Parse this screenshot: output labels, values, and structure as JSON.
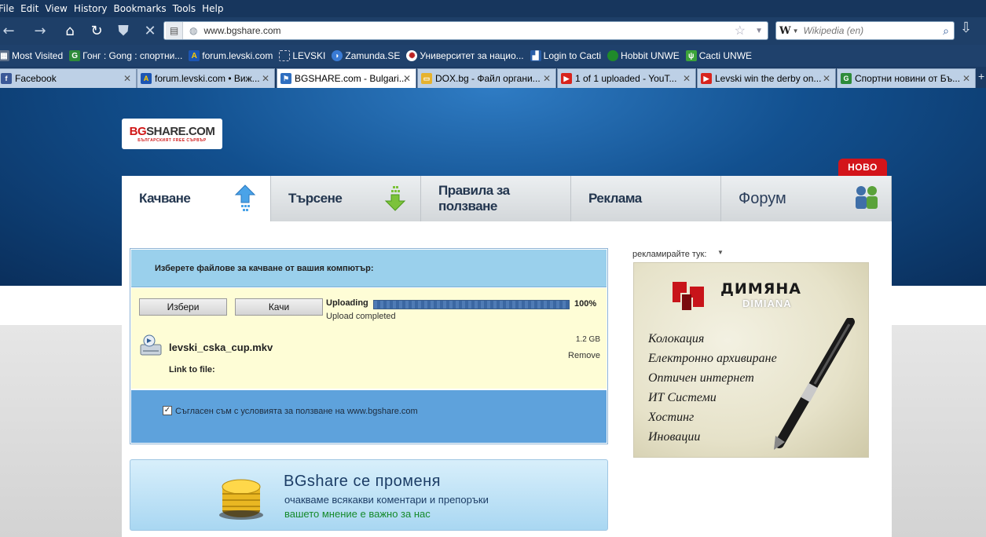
{
  "browser": {
    "menu": [
      "File",
      "Edit",
      "View",
      "History",
      "Bookmarks",
      "Tools",
      "Help"
    ],
    "url": "www.bgshare.com",
    "search_placeholder": "Wikipedia (en)",
    "search_engine_letter": "W",
    "bookmarks": [
      {
        "label": "Most Visited",
        "icon_color": "#5b6e88"
      },
      {
        "label": "Гонг : Gong : спортни...",
        "icon_color": "#2e8b3a"
      },
      {
        "label": "forum.levski.com",
        "icon_color": "#1c55b3"
      },
      {
        "label": "LEVSKI",
        "icon_color": "#ffffff"
      },
      {
        "label": "Zamunda.SE",
        "icon_color": "#3a7bd5"
      },
      {
        "label": "Университет за нацио...",
        "icon_color": "#b22"
      },
      {
        "label": "Login to Cacti",
        "icon_color": "#2a5fa8"
      },
      {
        "label": "Hobbit UNWE",
        "icon_color": "#1f8a2a"
      },
      {
        "label": "Cacti UNWE",
        "icon_color": "#3ca33a"
      }
    ],
    "tabs": [
      {
        "label": "Facebook",
        "icon_color": "#3b5998",
        "icon_text": "f"
      },
      {
        "label": "forum.levski.com • Виж...",
        "icon_color": "#1c55b3",
        "icon_text": "A"
      },
      {
        "label": "BGSHARE.com - Bulgari...",
        "icon_color": "#2f6fc0",
        "icon_text": "⚑"
      },
      {
        "label": "DOX.bg - Файл органи...",
        "icon_color": "#e6b22e",
        "icon_text": "▭"
      },
      {
        "label": "1 of 1 uploaded - YouT...",
        "icon_color": "#d8241d",
        "icon_text": "▶"
      },
      {
        "label": "Levski win the derby on...",
        "icon_color": "#d8241d",
        "icon_text": "▶"
      },
      {
        "label": "Спортни новини от Бъ...",
        "icon_color": "#2e8b3a",
        "icon_text": "G"
      }
    ]
  },
  "site": {
    "logo_red": "BG",
    "logo_rest": "SHARE.COM",
    "logo_sub": "БЪЛГАРСКИЯТ FREE СЪРВЪР",
    "new_badge": "НОВО",
    "tabs": [
      "Качване",
      "Търсене",
      "Правила за ползване",
      "Реклама",
      "Форум"
    ],
    "upload": {
      "heading": "Изберете файлове за качване от вашия компютър:",
      "choose_btn": "Избери",
      "upload_btn": "Качи",
      "status_label": "Uploading",
      "progress": 100,
      "progress_text": "100%",
      "status_detail": "Upload completed",
      "file_name": "levski_cska_cup.mkv",
      "file_size": "1.2 GB",
      "remove": "Remove",
      "link_label": "Link to file:",
      "agree_checked": true,
      "agree_text": "Съгласен съм с условията за ползване на www.bgshare.com"
    },
    "banner": {
      "title": "BGshare се променя",
      "line1": "очакваме всякакви коментари и препоръки",
      "line2": "вашето мнение е важно за нас"
    },
    "ad": {
      "label": "рекламирайте тук:",
      "brand": "ДИМЯНА",
      "brand_sub": "DIMIANA",
      "lines": [
        "Колокация",
        "Електронно архивиране",
        "Оптичен интернет",
        "ИТ Системи",
        "Хостинг",
        "Иновации"
      ]
    }
  }
}
